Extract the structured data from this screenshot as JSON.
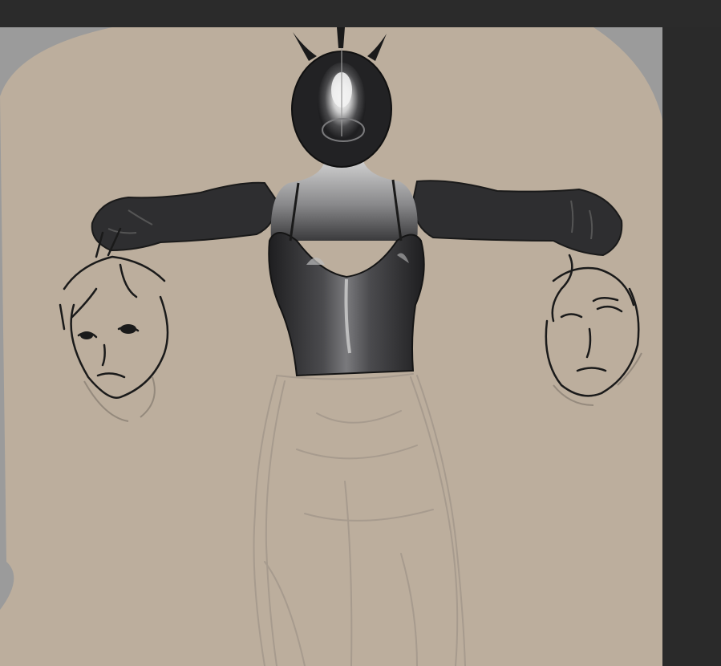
{
  "app": {
    "description_colors": {
      "chrome": "#2a2a2a",
      "canvas_backdrop": "#9b9b9b",
      "paper": "#bcae9d",
      "sketch_line": "#a2968a",
      "ink": "#1a1a1a",
      "figure_dark": "#2c2c2e",
      "figure_mid": "#6f6f72",
      "figure_light": "#d8d8d8"
    }
  },
  "canvas": {
    "icons": {
      "artwork": "drawing-canvas"
    }
  }
}
